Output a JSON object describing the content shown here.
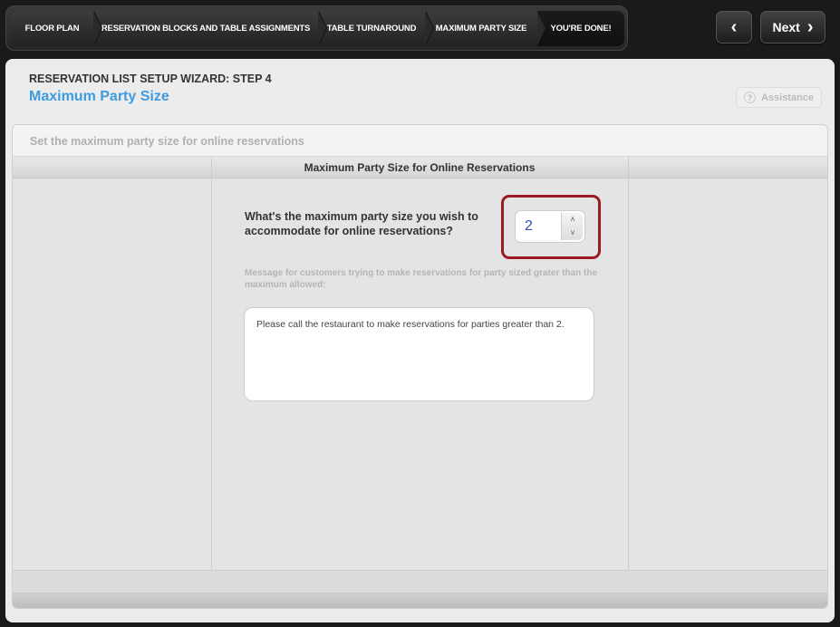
{
  "nav": {
    "steps": [
      {
        "label": "FLOOR PLAN"
      },
      {
        "label": "RESERVATION BLOCKS AND TABLE ASSIGNMENTS"
      },
      {
        "label": "TABLE TURNAROUND"
      },
      {
        "label": "MAXIMUM PARTY SIZE"
      },
      {
        "label": "YOU'RE DONE!"
      }
    ],
    "back_icon": "chevron-left-icon",
    "back_glyph": "‹",
    "next_label": "Next",
    "next_glyph": "›"
  },
  "header": {
    "wizard_step": "RESERVATION LIST SETUP WIZARD: STEP 4",
    "title": "Maximum Party Size",
    "assistance_icon": "?",
    "assistance_label": "Assistance"
  },
  "section": {
    "subheading": "Set the maximum party size for online reservations",
    "column_title": "Maximum Party Size for Online Reservations",
    "question": "What's the maximum party size you wish to accommodate for online reservations?",
    "max_party_size": "2",
    "spin_up_glyph": "˄",
    "spin_down_glyph": "˅",
    "message_label": "Message for customers trying to make reservations for party sized grater than the maximum allowed:",
    "message_text": "Please call the restaurant to make reservations for parties greater than 2."
  },
  "colors": {
    "title_blue": "#3d9be0",
    "highlight_red": "#9b1b24"
  }
}
